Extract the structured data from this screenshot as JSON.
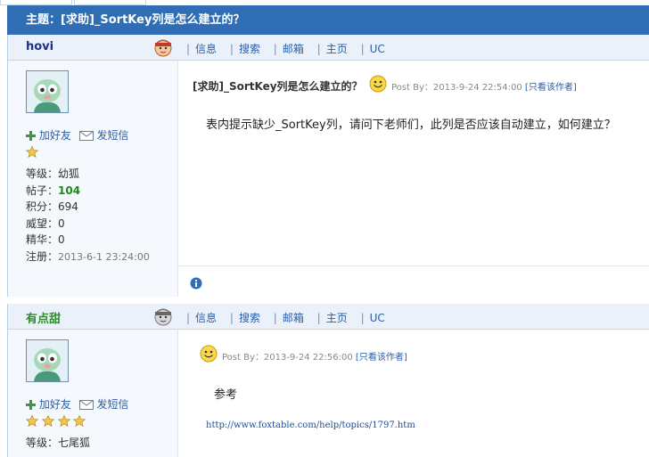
{
  "thread": {
    "title": "主题：[求助]_SortKey列是怎么建立的？"
  },
  "nav": {
    "links": [
      "信息",
      "搜索",
      "邮箱",
      "主页",
      "UC"
    ]
  },
  "posts": [
    {
      "username": "hovi",
      "username_color": "#1a2f8a",
      "actions": {
        "add_friend": "加好友",
        "send_message": "发短信"
      },
      "stars": 1,
      "stats": {
        "level": "等级：幼狐",
        "posts_label": "帖子：",
        "posts": "104",
        "points": "积分：694",
        "prestige": "威望：0",
        "essence": "精华：0",
        "register_label": "注册：",
        "register_date": "2013-6-1 23:24:00"
      },
      "title": "[求助]_SortKey列是怎么建立的？",
      "meta": {
        "posted": "Post By：2013-9-24 22:54:00",
        "view_author": "[只看该作者]"
      },
      "body": "表内提示缺少_SortKey列，请问下老师们，此列是否应该自动建立，如何建立？"
    },
    {
      "username": "有点甜",
      "username_color": "#2e8b2e",
      "actions": {
        "add_friend": "加好友",
        "send_message": "发短信"
      },
      "stars": 4,
      "stats": {
        "level": "等级：七尾狐"
      },
      "meta": {
        "posted": "Post By：2013-9-24 22:56:00",
        "view_author": "[只看该作者]"
      },
      "body": "参考",
      "url": "http://www.foxtable.com/help/topics/1797.htm"
    }
  ],
  "colors": {
    "header_blue": "#2f6db5",
    "link_blue": "#2a5ea8",
    "post_head": "#eaf1fa"
  }
}
